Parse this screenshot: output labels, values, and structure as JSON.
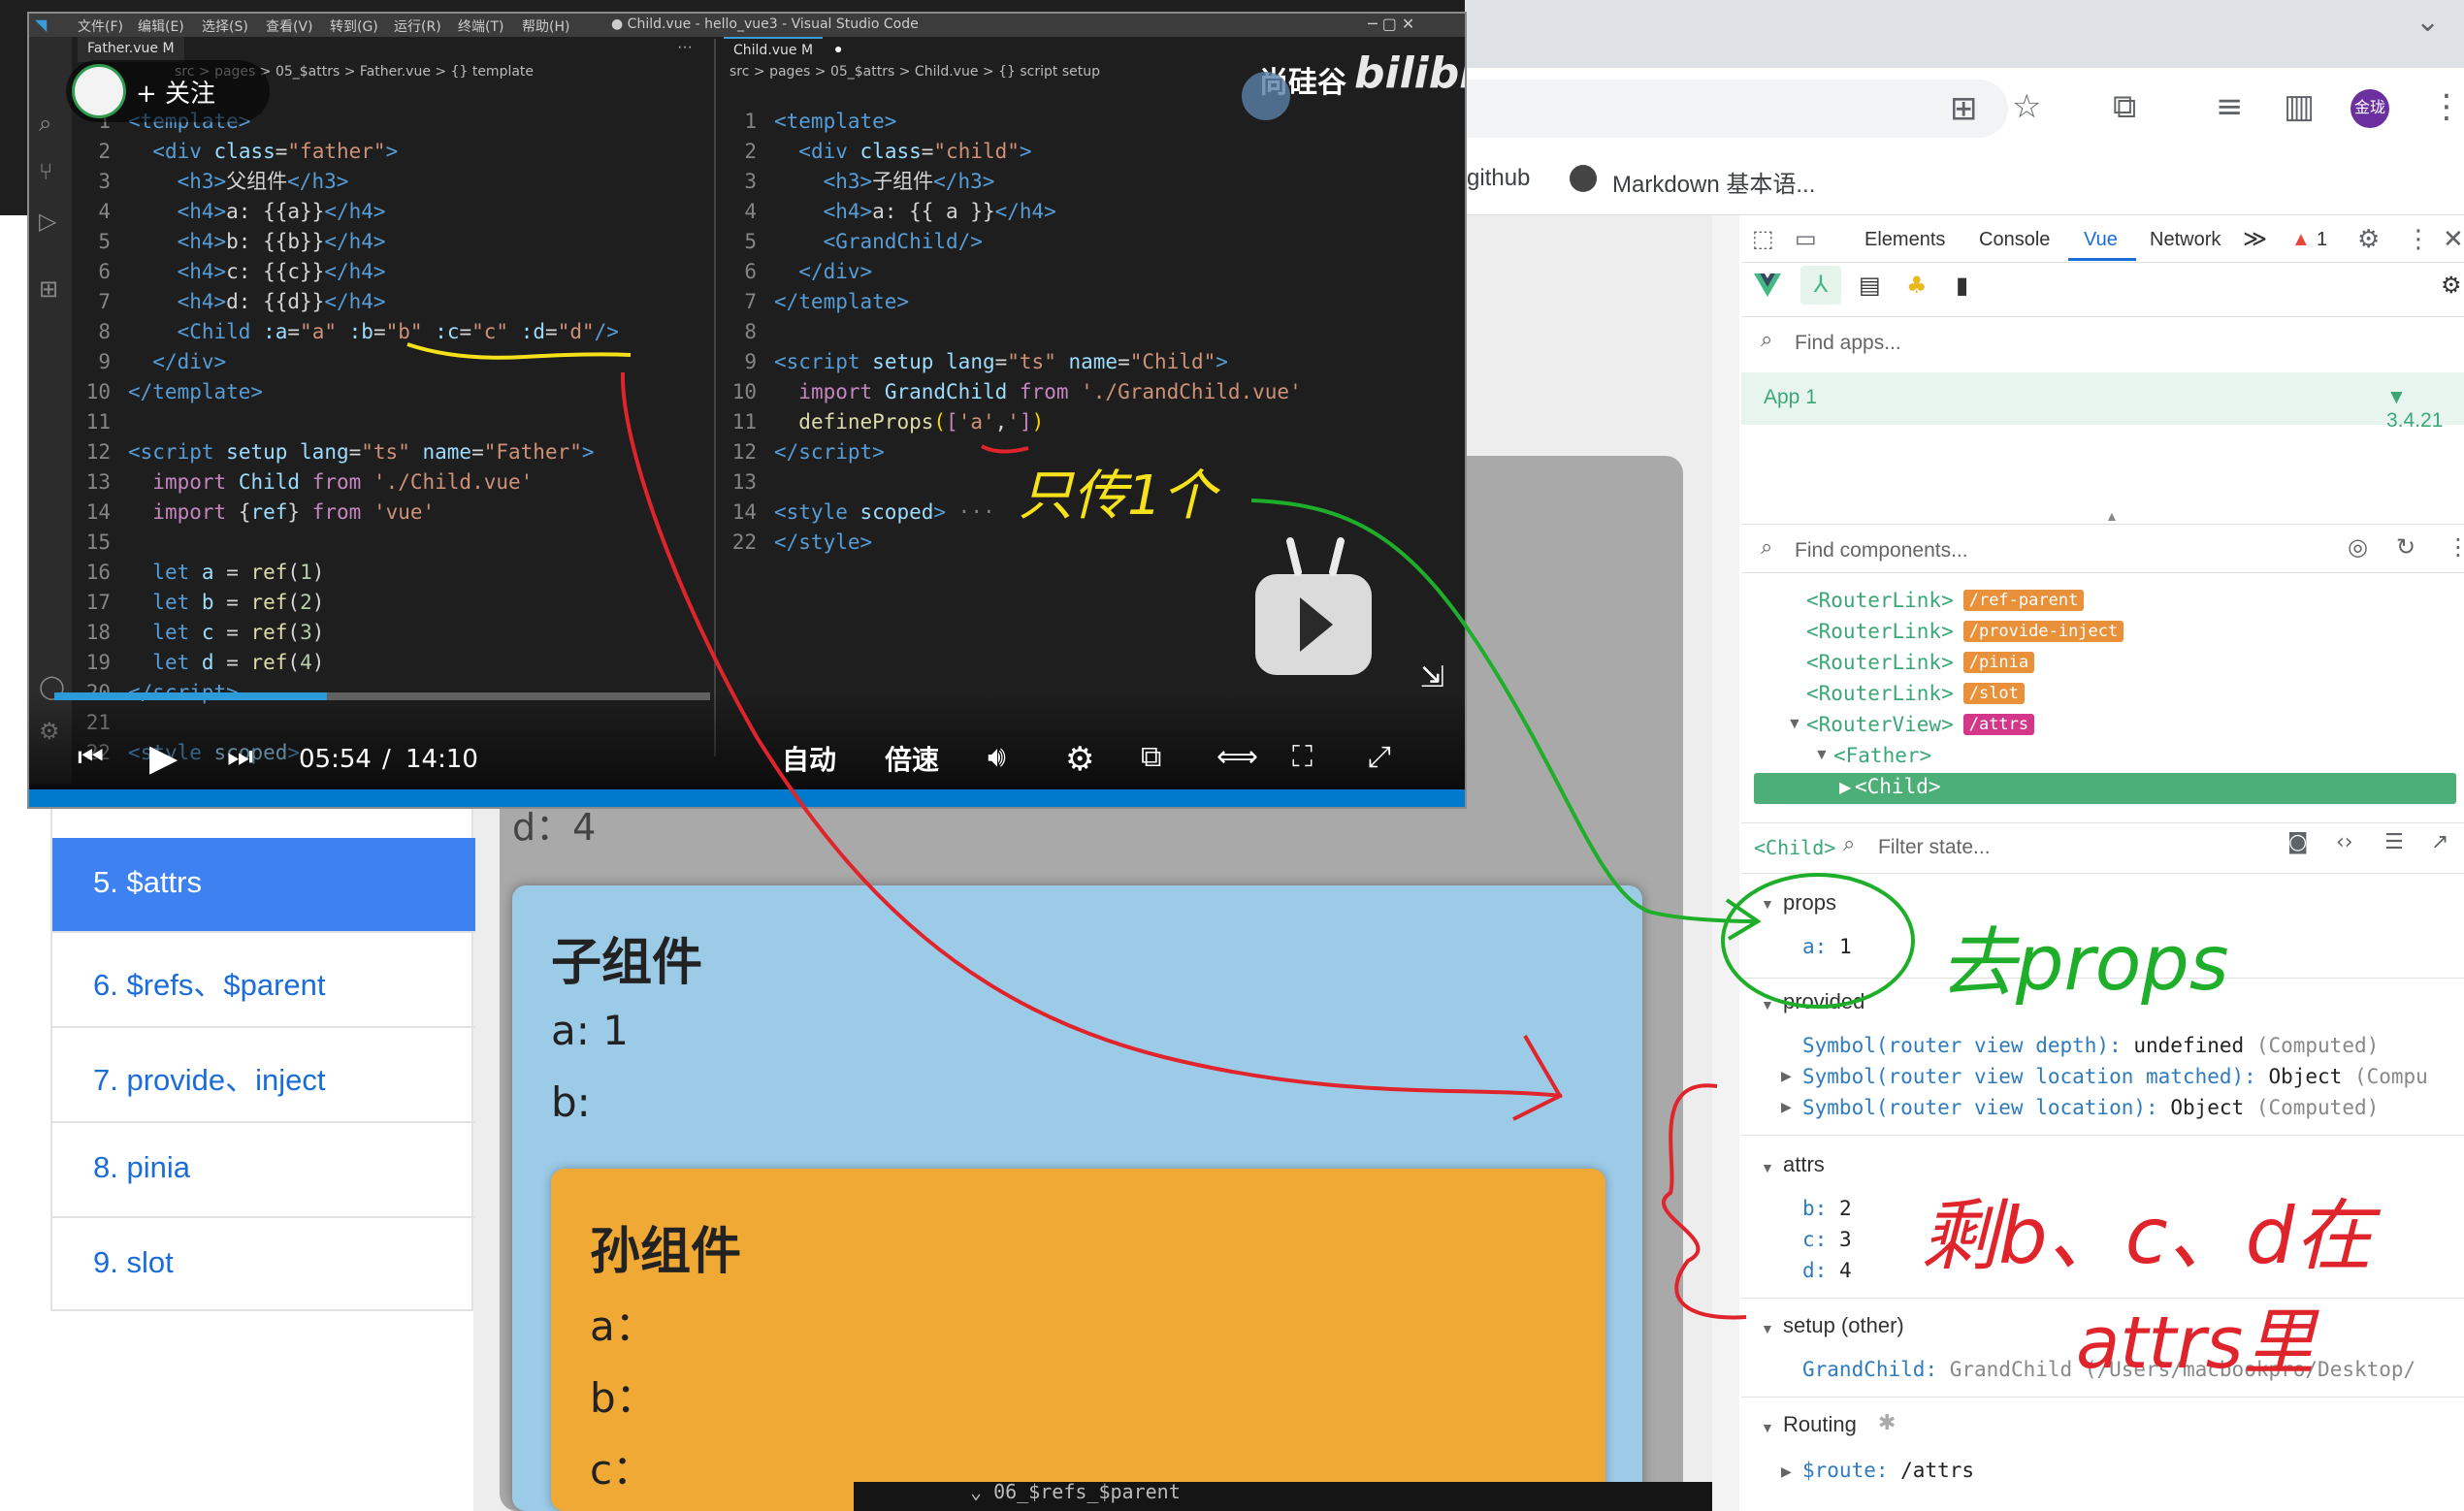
{
  "browser": {
    "bookmarks": [
      "github",
      "Markdown 基本语..."
    ],
    "profile_label": "金珑"
  },
  "nav": {
    "items": [
      {
        "label": "5. $attrs",
        "active": true
      },
      {
        "label": "6. $refs、$parent",
        "active": false
      },
      {
        "label": "7. provide、inject",
        "active": false
      },
      {
        "label": "8. pinia",
        "active": false
      },
      {
        "label": "9. slot",
        "active": false
      }
    ]
  },
  "page": {
    "parent_d_line": "d：4",
    "child": {
      "title": "子组件",
      "a": "a: 1",
      "b": "b:"
    },
    "grandchild": {
      "title": "孙组件",
      "a": "a：",
      "b": "b：",
      "c": "c："
    },
    "background_text": "⌄ 06_$refs_$parent"
  },
  "devtools": {
    "tabs": [
      "Elements",
      "Console",
      "Vue",
      "Network"
    ],
    "active_tab": "Vue",
    "overflow": "≫",
    "warnings": "1",
    "find_apps_placeholder": "Find apps...",
    "app_name": "App 1",
    "vue_version": "3.4.21",
    "find_components_placeholder": "Find components...",
    "tree": [
      {
        "tag": "<RouterLink>",
        "badge": "/ref-parent",
        "color": "#e8913a"
      },
      {
        "tag": "<RouterLink>",
        "badge": "/provide-inject",
        "color": "#e8913a"
      },
      {
        "tag": "<RouterLink>",
        "badge": "/pinia",
        "color": "#e8913a"
      },
      {
        "tag": "<RouterLink>",
        "badge": "/slot",
        "color": "#e8913a"
      },
      {
        "tag": "<RouterView>",
        "badge": "/attrs",
        "color": "#d4378a"
      },
      {
        "tag": "<Father>",
        "badge": "",
        "color": ""
      },
      {
        "tag": "<Child>",
        "badge": "",
        "color": ""
      }
    ],
    "selected_component": "<Child>",
    "filter_state_placeholder": "Filter state...",
    "sections": {
      "props": {
        "title": "props",
        "rows": [
          {
            "key": "a",
            "value": "1"
          }
        ]
      },
      "provided": {
        "title": "provided",
        "rows": [
          {
            "key": "Symbol(router view depth)",
            "value": "undefined",
            "note": "(Computed)"
          },
          {
            "key": "Symbol(router view location matched)",
            "value": "Object",
            "note": "(Compu"
          },
          {
            "key": "Symbol(router view location)",
            "value": "Object",
            "note": "(Computed)"
          }
        ]
      },
      "attrs": {
        "title": "attrs",
        "rows": [
          {
            "key": "b",
            "value": "2"
          },
          {
            "key": "c",
            "value": "3"
          },
          {
            "key": "d",
            "value": "4"
          }
        ]
      },
      "setup": {
        "title": "setup (other)",
        "rows": [
          {
            "key": "GrandChild",
            "value": "GrandChild",
            "note": "(/Users/macbookpro/Desktop/"
          }
        ]
      },
      "routing": {
        "title": "Routing",
        "rows": [
          {
            "key": "$route",
            "value": "/attrs"
          }
        ]
      }
    }
  },
  "video": {
    "window_title": "● Child.vue - hello_vue3 - Visual Studio Code",
    "menu": [
      "文件(F)",
      "编辑(E)",
      "选择(S)",
      "查看(V)",
      "转到(G)",
      "运行(R)",
      "终端(T)",
      "帮助(H)"
    ],
    "left_tab": "Father.vue M",
    "right_tab": "Child.vue M",
    "left_breadcrumb": "src > pages > 05_$attrs > Father.vue > {} template",
    "right_breadcrumb": "src > pages > 05_$attrs > Child.vue > {} script setup",
    "follow_label": "+ 关注",
    "watermark": "尚硅谷",
    "watermark_logo": "bilibili",
    "current_time": "05:54",
    "time_separator": "/",
    "total_time": "14:10",
    "quality": "自动",
    "speed": "倍速",
    "progress": 0.415,
    "left_code": [
      {
        "n": "1",
        "html": "<span class='t-tag'>&lt;template&gt;</span>"
      },
      {
        "n": "2",
        "html": "  <span class='t-tag'>&lt;div</span> <span class='t-attr'>class</span>=<span class='t-str'>\"father\"</span><span class='t-tag'>&gt;</span>"
      },
      {
        "n": "3",
        "html": "    <span class='t-tag'>&lt;h3&gt;</span><span class='t-txt'>父组件</span><span class='t-tag'>&lt;/h3&gt;</span>"
      },
      {
        "n": "4",
        "html": "    <span class='t-tag'>&lt;h4&gt;</span><span class='t-txt'>a: {{a}}</span><span class='t-tag'>&lt;/h4&gt;</span>"
      },
      {
        "n": "5",
        "html": "    <span class='t-tag'>&lt;h4&gt;</span><span class='t-txt'>b: {{b}}</span><span class='t-tag'>&lt;/h4&gt;</span>"
      },
      {
        "n": "6",
        "html": "    <span class='t-tag'>&lt;h4&gt;</span><span class='t-txt'>c: {{c}}</span><span class='t-tag'>&lt;/h4&gt;</span>"
      },
      {
        "n": "7",
        "html": "    <span class='t-tag'>&lt;h4&gt;</span><span class='t-txt'>d: {{d}}</span><span class='t-tag'>&lt;/h4&gt;</span>"
      },
      {
        "n": "8",
        "html": "    <span class='t-tag'>&lt;Child</span> <span class='t-attr'>:a</span>=<span class='t-str'>\"a\"</span> <span class='t-attr'>:b</span>=<span class='t-str'>\"b\"</span> <span class='t-attr'>:c</span>=<span class='t-str'>\"c\"</span> <span class='t-attr'>:d</span>=<span class='t-str'>\"d\"</span><span class='t-tag'>/&gt;</span>"
      },
      {
        "n": "9",
        "html": "  <span class='t-tag'>&lt;/div&gt;</span>"
      },
      {
        "n": "10",
        "html": "<span class='t-tag'>&lt;/template&gt;</span>"
      },
      {
        "n": "11",
        "html": ""
      },
      {
        "n": "12",
        "html": "<span class='t-tag'>&lt;script</span> <span class='t-attr'>setup lang</span>=<span class='t-str'>\"ts\"</span> <span class='t-attr'>name</span>=<span class='t-str'>\"Father\"</span><span class='t-tag'>&gt;</span>"
      },
      {
        "n": "13",
        "html": "  <span class='t-kw2'>import</span> <span class='t-attr'>Child</span> <span class='t-kw2'>from</span> <span class='t-str'>'./Child.vue'</span>"
      },
      {
        "n": "14",
        "html": "  <span class='t-kw2'>import</span> <span class='t-txt'>{</span><span class='t-attr'>ref</span><span class='t-txt'>}</span> <span class='t-kw2'>from</span> <span class='t-str'>'vue'</span>"
      },
      {
        "n": "15",
        "html": ""
      },
      {
        "n": "16",
        "html": "  <span class='t-kw'>let</span> <span class='t-attr'>a</span> = <span class='t-fn'>ref</span>(<span class='t-num'>1</span>)"
      },
      {
        "n": "17",
        "html": "  <span class='t-kw'>let</span> <span class='t-attr'>b</span> = <span class='t-fn'>ref</span>(<span class='t-num'>2</span>)"
      },
      {
        "n": "18",
        "html": "  <span class='t-kw'>let</span> <span class='t-attr'>c</span> = <span class='t-fn'>ref</span>(<span class='t-num'>3</span>)"
      },
      {
        "n": "19",
        "html": "  <span class='t-kw'>let</span> <span class='t-attr'>d</span> = <span class='t-fn'>ref</span>(<span class='t-num'>4</span>)"
      },
      {
        "n": "20",
        "html": "<span class='t-tag'>&lt;/script&gt;</span>"
      },
      {
        "n": "21",
        "html": ""
      },
      {
        "n": "22",
        "html": "<span class='t-tag'>&lt;style</span> <span class='t-attr'>scoped</span><span class='t-tag'>&gt;</span>"
      }
    ],
    "right_code": [
      {
        "n": "1",
        "html": "<span class='t-tag'>&lt;template&gt;</span>"
      },
      {
        "n": "2",
        "html": "  <span class='t-tag'>&lt;div</span> <span class='t-attr'>class</span>=<span class='t-str'>\"child\"</span><span class='t-tag'>&gt;</span>"
      },
      {
        "n": "3",
        "html": "    <span class='t-tag'>&lt;h3&gt;</span><span class='t-txt'>子组件</span><span class='t-tag'>&lt;/h3&gt;</span>"
      },
      {
        "n": "4",
        "html": "    <span class='t-tag'>&lt;h4&gt;</span><span class='t-txt'>a: {{ a }}</span><span class='t-tag'>&lt;/h4&gt;</span>"
      },
      {
        "n": "5",
        "html": "    <span class='t-tag'>&lt;GrandChild/&gt;</span>"
      },
      {
        "n": "6",
        "html": "  <span class='t-tag'>&lt;/div&gt;</span>"
      },
      {
        "n": "7",
        "html": "<span class='t-tag'>&lt;/template&gt;</span>"
      },
      {
        "n": "8",
        "html": ""
      },
      {
        "n": "9",
        "html": "<span class='t-tag'>&lt;script</span> <span class='t-attr'>setup lang</span>=<span class='t-str'>\"ts\"</span> <span class='t-attr'>name</span>=<span class='t-str'>\"Child\"</span><span class='t-tag'>&gt;</span>"
      },
      {
        "n": "10",
        "html": "  <span class='t-kw2'>import</span> <span class='t-attr'>GrandChild</span> <span class='t-kw2'>from</span> <span class='t-str'>'./GrandChild.vue'</span>"
      },
      {
        "n": "11",
        "html": "  <span class='t-fn'>defineProps</span><span class='t-br'>(</span><span class='t-kw2'>[</span><span class='t-str'>'a'</span>,<span class='t-str'>'</span><span class='t-kw2'>]</span><span class='t-br'>)</span>"
      },
      {
        "n": "12",
        "html": "<span class='t-tag'>&lt;/script&gt;</span>"
      },
      {
        "n": "13",
        "html": ""
      },
      {
        "n": "14",
        "html": "<span class='t-tag'>&lt;style</span> <span class='t-attr'>scoped</span><span class='t-tag'>&gt;</span><span class='t-gray'> ···</span>"
      },
      {
        "n": "22",
        "html": "<span class='t-tag'>&lt;/style&gt;</span>"
      }
    ]
  },
  "annotations": {
    "note_pass_one": "只传1个",
    "note_props": "去props",
    "note_attrs_1": "剩b、c、d在",
    "note_attrs_2": "attrs里"
  },
  "colors": {
    "red_arrow": "#e0242b",
    "green_arrow": "#1fae2a",
    "vue_green": "#42b883",
    "nav_active": "#3d82f0"
  }
}
